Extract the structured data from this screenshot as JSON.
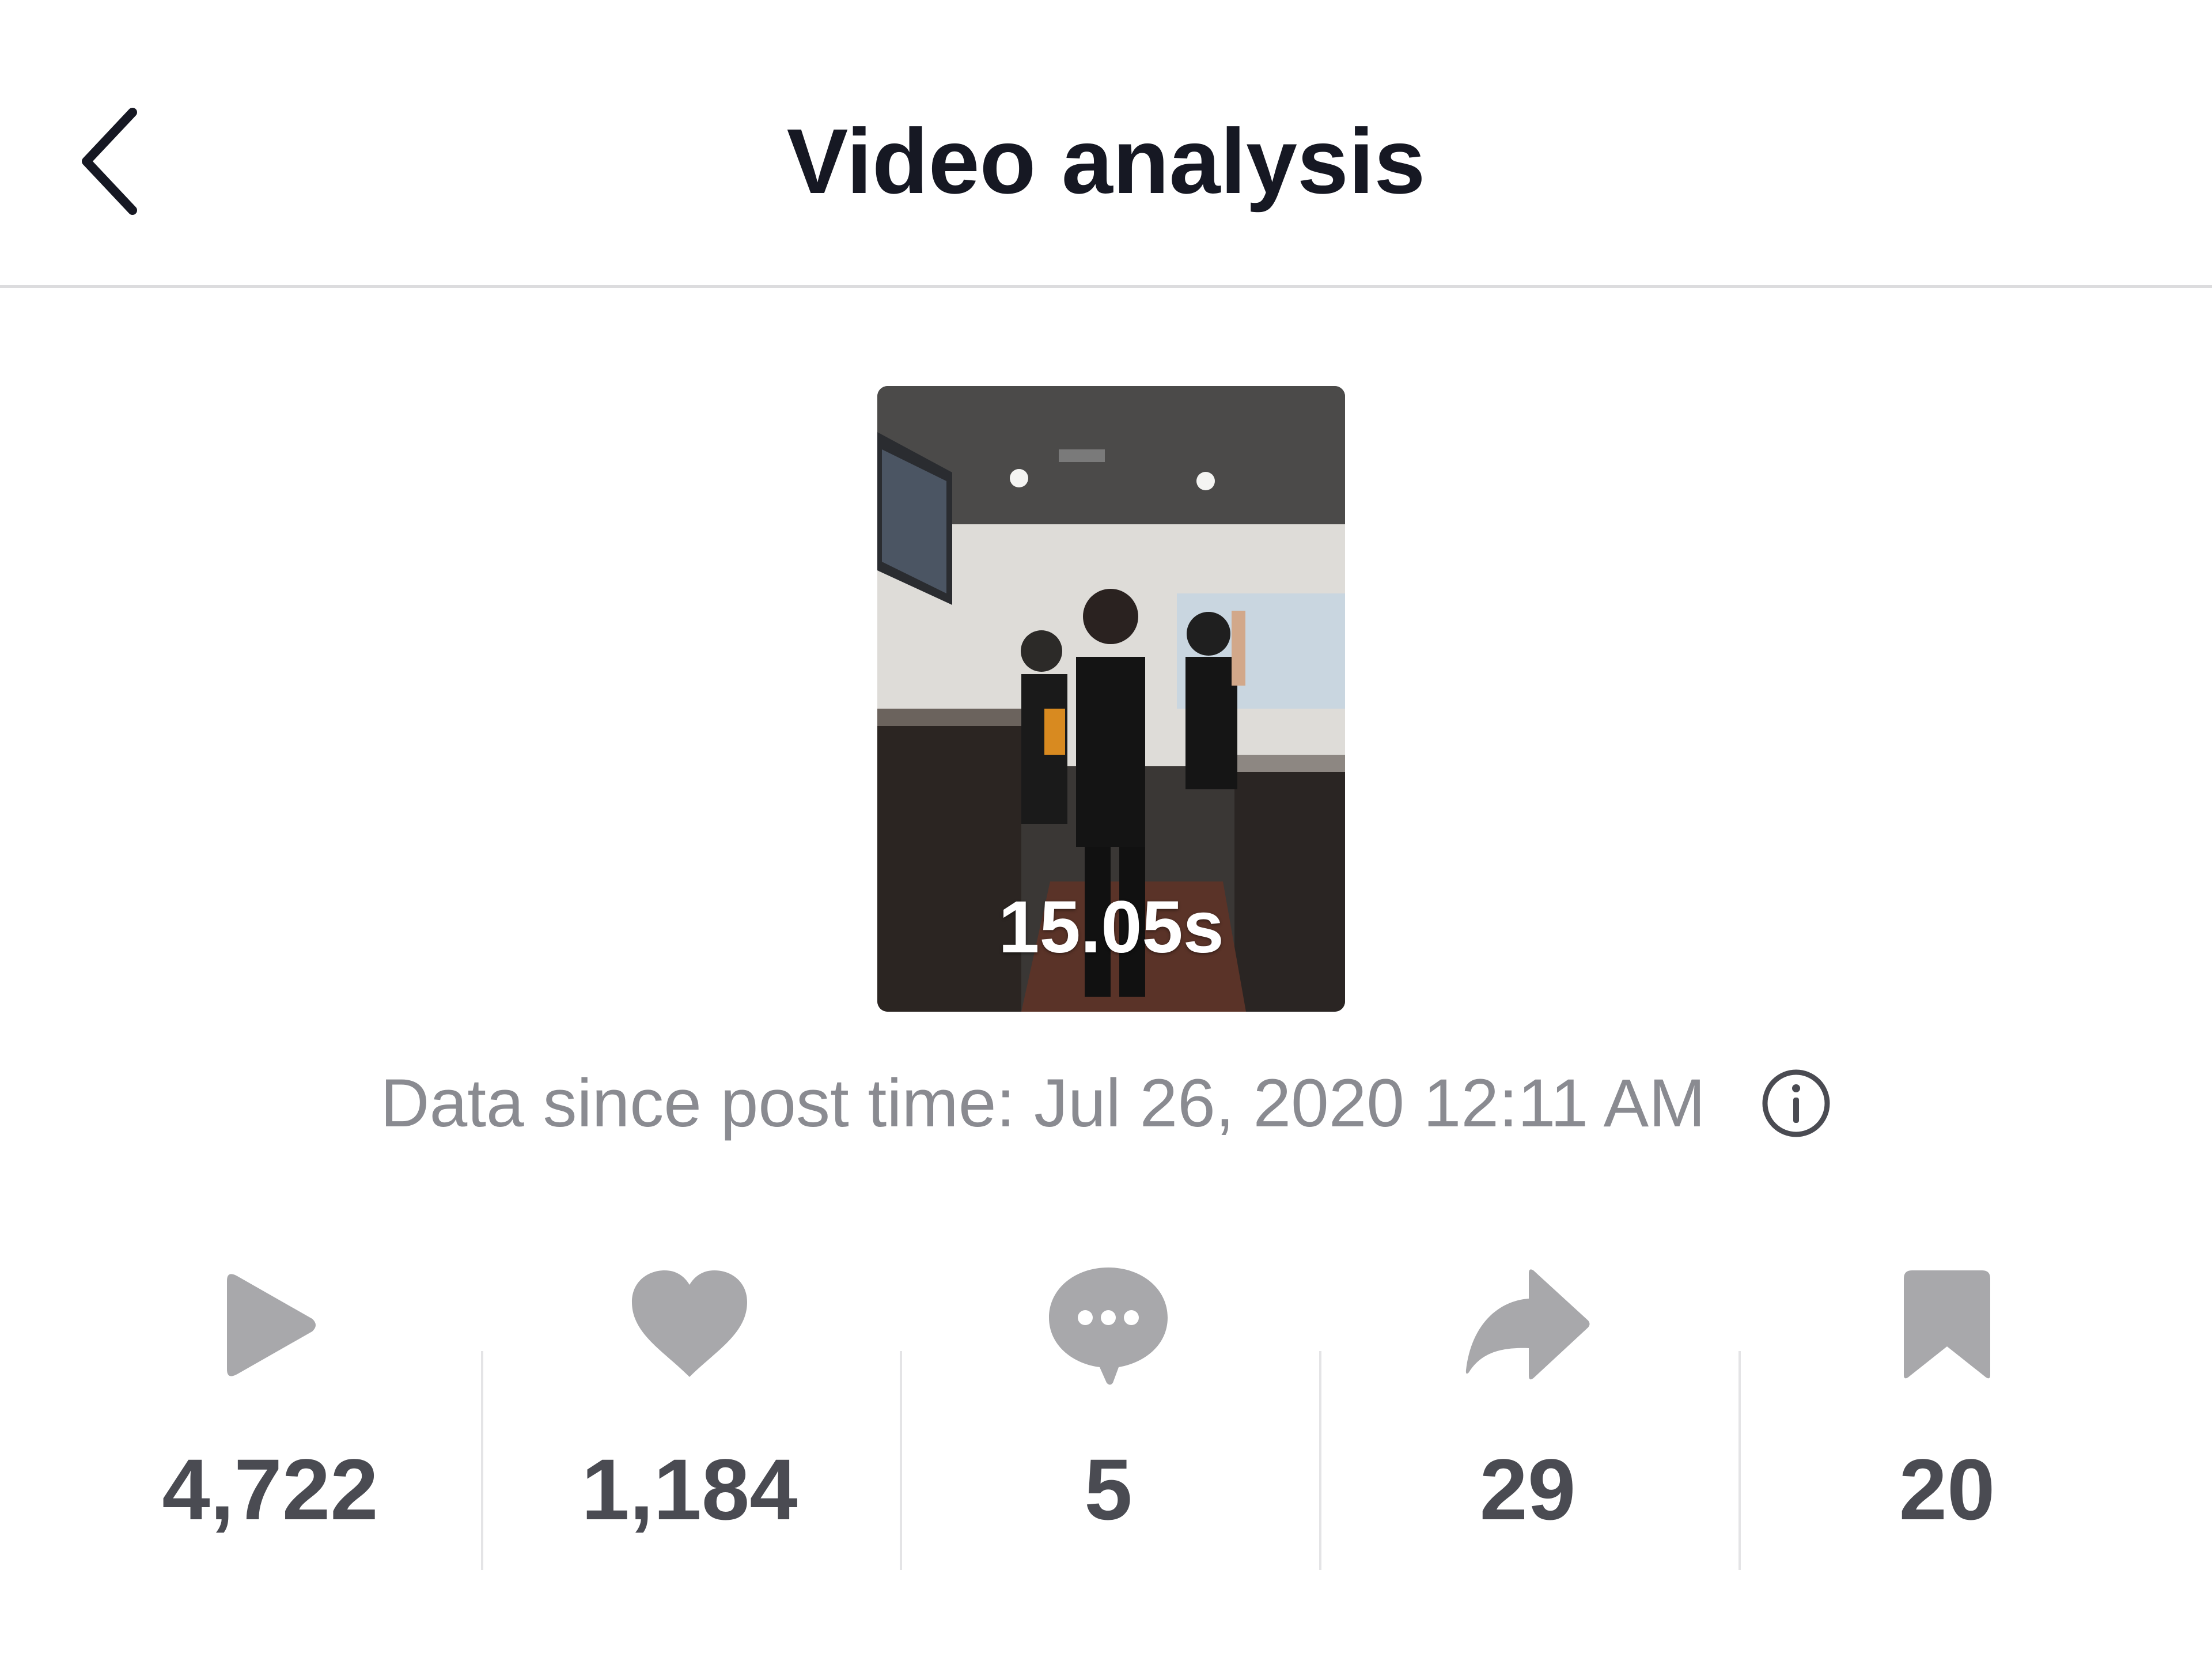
{
  "header": {
    "title": "Video analysis",
    "back_icon": "chevron-left-icon"
  },
  "video": {
    "duration": "15.05s"
  },
  "post_time": {
    "text": "Data since post time: Jul 26, 2020 12:11 AM",
    "info_icon": "info-icon"
  },
  "stats": [
    {
      "icon": "play-icon",
      "value": "4,722"
    },
    {
      "icon": "heart-icon",
      "value": "1,184"
    },
    {
      "icon": "comment-icon",
      "value": "5"
    },
    {
      "icon": "share-icon",
      "value": "29"
    },
    {
      "icon": "bookmark-icon",
      "value": "20"
    }
  ],
  "colors": {
    "title": "#161823",
    "secondary_text": "#8a8b91",
    "stat_icon": "#a8a8ab",
    "stat_value": "#4a4b52",
    "divider": "#e4e4e6"
  }
}
